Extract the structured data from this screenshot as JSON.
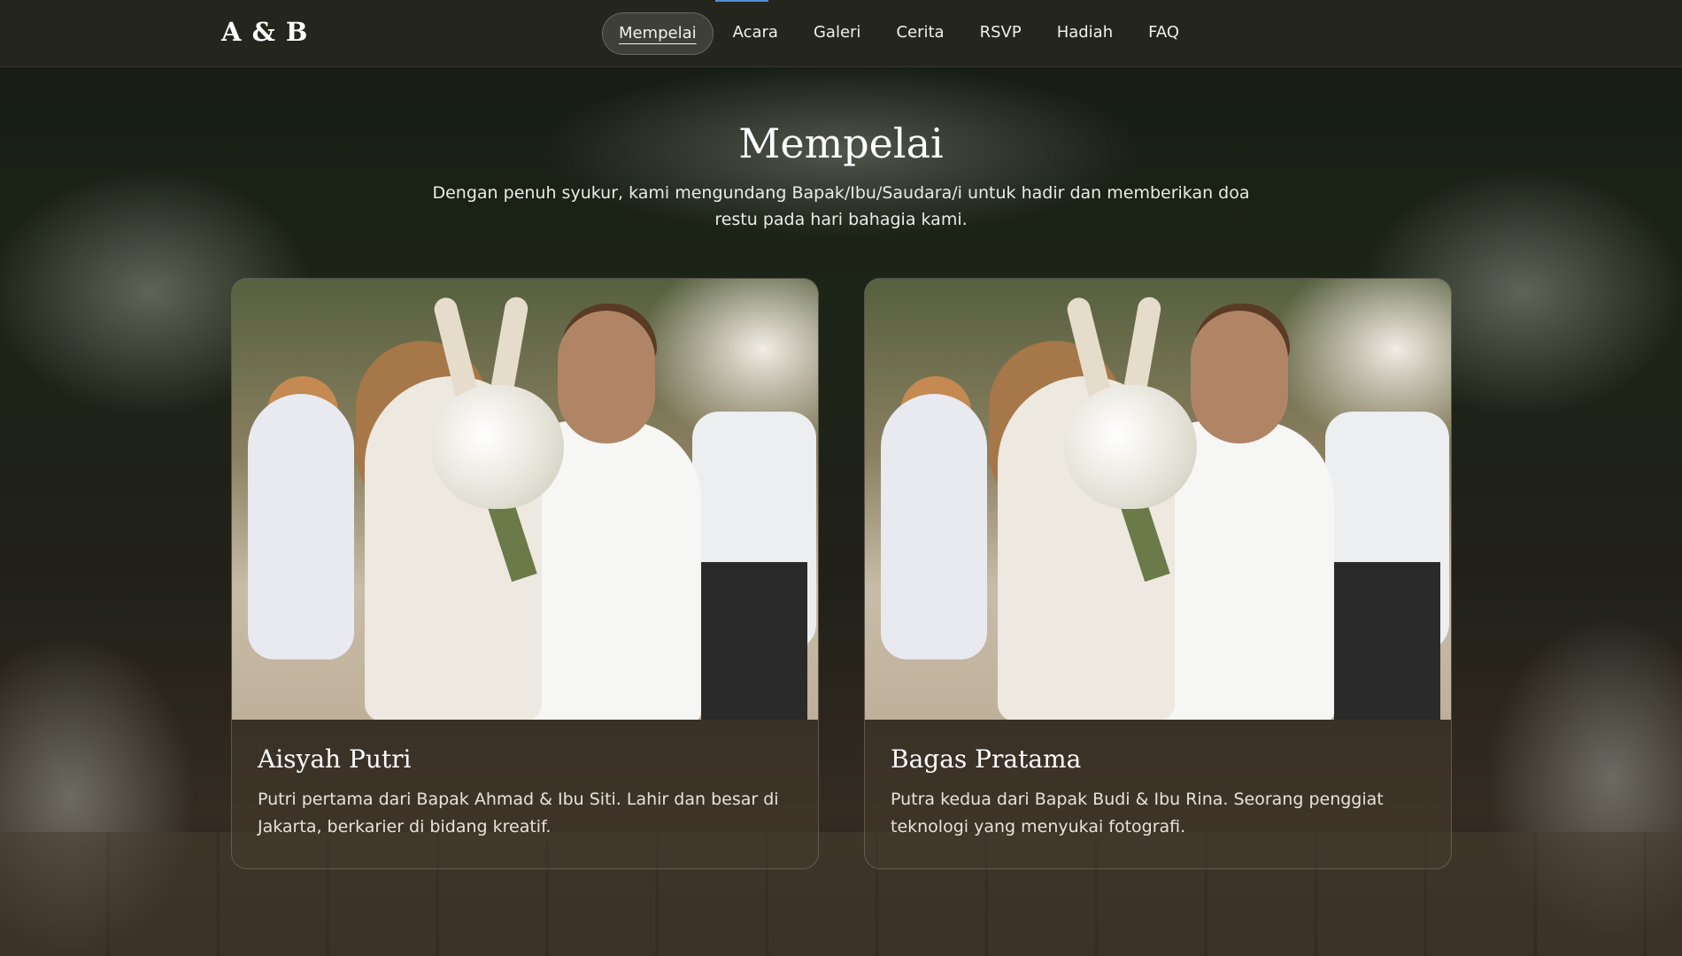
{
  "header": {
    "logo": "A & B",
    "nav": [
      {
        "label": "Mempelai",
        "active": true
      },
      {
        "label": "Acara"
      },
      {
        "label": "Galeri"
      },
      {
        "label": "Cerita"
      },
      {
        "label": "RSVP"
      },
      {
        "label": "Hadiah"
      },
      {
        "label": "FAQ"
      }
    ]
  },
  "section": {
    "title": "Mempelai",
    "subtitle": "Dengan penuh syukur, kami mengundang Bapak/Ibu/Saudara/i untuk hadir dan memberikan doa restu pada hari bahagia kami."
  },
  "couple": [
    {
      "name": "Aisyah Putri",
      "description": "Putri pertama dari Bapak Ahmad & Ibu Siti. Lahir dan besar di Jakarta, berkarier di bidang kreatif."
    },
    {
      "name": "Bagas Pratama",
      "description": "Putra kedua dari Bapak Budi & Ibu Rina. Seorang penggiat teknologi yang menyukai fotografi."
    }
  ],
  "colors": {
    "accent": "#4e8fd6",
    "topbar": "#26261e"
  }
}
